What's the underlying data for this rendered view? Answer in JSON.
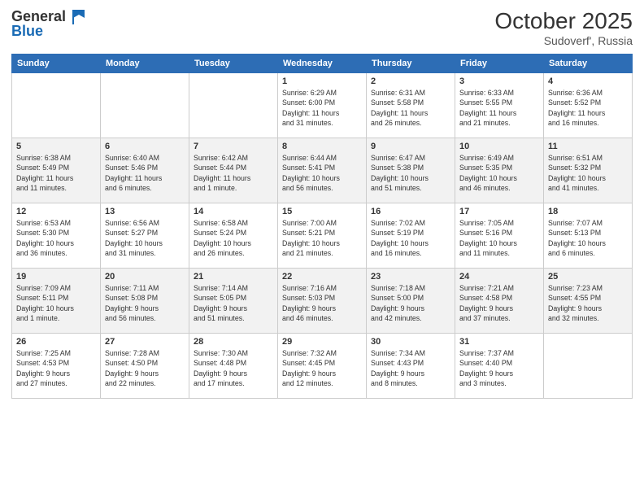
{
  "header": {
    "logo_line1": "General",
    "logo_line2": "Blue",
    "month": "October 2025",
    "location": "Sudoverf', Russia"
  },
  "weekdays": [
    "Sunday",
    "Monday",
    "Tuesday",
    "Wednesday",
    "Thursday",
    "Friday",
    "Saturday"
  ],
  "weeks": [
    [
      {
        "day": "",
        "info": ""
      },
      {
        "day": "",
        "info": ""
      },
      {
        "day": "",
        "info": ""
      },
      {
        "day": "1",
        "info": "Sunrise: 6:29 AM\nSunset: 6:00 PM\nDaylight: 11 hours\nand 31 minutes."
      },
      {
        "day": "2",
        "info": "Sunrise: 6:31 AM\nSunset: 5:58 PM\nDaylight: 11 hours\nand 26 minutes."
      },
      {
        "day": "3",
        "info": "Sunrise: 6:33 AM\nSunset: 5:55 PM\nDaylight: 11 hours\nand 21 minutes."
      },
      {
        "day": "4",
        "info": "Sunrise: 6:36 AM\nSunset: 5:52 PM\nDaylight: 11 hours\nand 16 minutes."
      }
    ],
    [
      {
        "day": "5",
        "info": "Sunrise: 6:38 AM\nSunset: 5:49 PM\nDaylight: 11 hours\nand 11 minutes."
      },
      {
        "day": "6",
        "info": "Sunrise: 6:40 AM\nSunset: 5:46 PM\nDaylight: 11 hours\nand 6 minutes."
      },
      {
        "day": "7",
        "info": "Sunrise: 6:42 AM\nSunset: 5:44 PM\nDaylight: 11 hours\nand 1 minute."
      },
      {
        "day": "8",
        "info": "Sunrise: 6:44 AM\nSunset: 5:41 PM\nDaylight: 10 hours\nand 56 minutes."
      },
      {
        "day": "9",
        "info": "Sunrise: 6:47 AM\nSunset: 5:38 PM\nDaylight: 10 hours\nand 51 minutes."
      },
      {
        "day": "10",
        "info": "Sunrise: 6:49 AM\nSunset: 5:35 PM\nDaylight: 10 hours\nand 46 minutes."
      },
      {
        "day": "11",
        "info": "Sunrise: 6:51 AM\nSunset: 5:32 PM\nDaylight: 10 hours\nand 41 minutes."
      }
    ],
    [
      {
        "day": "12",
        "info": "Sunrise: 6:53 AM\nSunset: 5:30 PM\nDaylight: 10 hours\nand 36 minutes."
      },
      {
        "day": "13",
        "info": "Sunrise: 6:56 AM\nSunset: 5:27 PM\nDaylight: 10 hours\nand 31 minutes."
      },
      {
        "day": "14",
        "info": "Sunrise: 6:58 AM\nSunset: 5:24 PM\nDaylight: 10 hours\nand 26 minutes."
      },
      {
        "day": "15",
        "info": "Sunrise: 7:00 AM\nSunset: 5:21 PM\nDaylight: 10 hours\nand 21 minutes."
      },
      {
        "day": "16",
        "info": "Sunrise: 7:02 AM\nSunset: 5:19 PM\nDaylight: 10 hours\nand 16 minutes."
      },
      {
        "day": "17",
        "info": "Sunrise: 7:05 AM\nSunset: 5:16 PM\nDaylight: 10 hours\nand 11 minutes."
      },
      {
        "day": "18",
        "info": "Sunrise: 7:07 AM\nSunset: 5:13 PM\nDaylight: 10 hours\nand 6 minutes."
      }
    ],
    [
      {
        "day": "19",
        "info": "Sunrise: 7:09 AM\nSunset: 5:11 PM\nDaylight: 10 hours\nand 1 minute."
      },
      {
        "day": "20",
        "info": "Sunrise: 7:11 AM\nSunset: 5:08 PM\nDaylight: 9 hours\nand 56 minutes."
      },
      {
        "day": "21",
        "info": "Sunrise: 7:14 AM\nSunset: 5:05 PM\nDaylight: 9 hours\nand 51 minutes."
      },
      {
        "day": "22",
        "info": "Sunrise: 7:16 AM\nSunset: 5:03 PM\nDaylight: 9 hours\nand 46 minutes."
      },
      {
        "day": "23",
        "info": "Sunrise: 7:18 AM\nSunset: 5:00 PM\nDaylight: 9 hours\nand 42 minutes."
      },
      {
        "day": "24",
        "info": "Sunrise: 7:21 AM\nSunset: 4:58 PM\nDaylight: 9 hours\nand 37 minutes."
      },
      {
        "day": "25",
        "info": "Sunrise: 7:23 AM\nSunset: 4:55 PM\nDaylight: 9 hours\nand 32 minutes."
      }
    ],
    [
      {
        "day": "26",
        "info": "Sunrise: 7:25 AM\nSunset: 4:53 PM\nDaylight: 9 hours\nand 27 minutes."
      },
      {
        "day": "27",
        "info": "Sunrise: 7:28 AM\nSunset: 4:50 PM\nDaylight: 9 hours\nand 22 minutes."
      },
      {
        "day": "28",
        "info": "Sunrise: 7:30 AM\nSunset: 4:48 PM\nDaylight: 9 hours\nand 17 minutes."
      },
      {
        "day": "29",
        "info": "Sunrise: 7:32 AM\nSunset: 4:45 PM\nDaylight: 9 hours\nand 12 minutes."
      },
      {
        "day": "30",
        "info": "Sunrise: 7:34 AM\nSunset: 4:43 PM\nDaylight: 9 hours\nand 8 minutes."
      },
      {
        "day": "31",
        "info": "Sunrise: 7:37 AM\nSunset: 4:40 PM\nDaylight: 9 hours\nand 3 minutes."
      },
      {
        "day": "",
        "info": ""
      }
    ]
  ]
}
